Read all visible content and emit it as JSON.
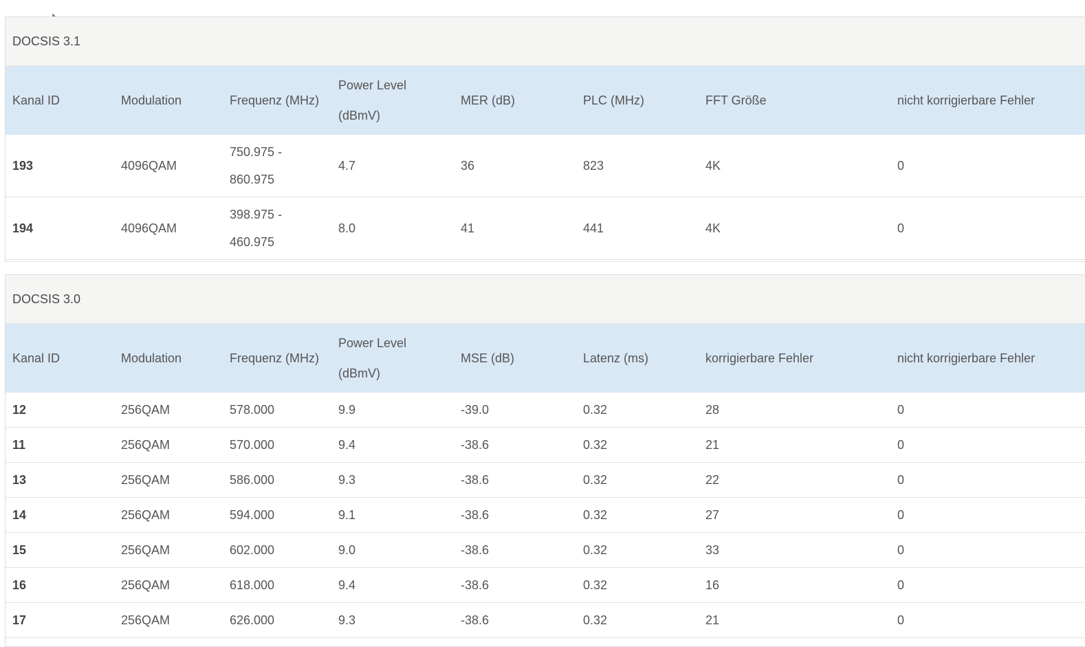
{
  "docsis31": {
    "title": "DOCSIS 3.1",
    "headers": [
      "Kanal ID",
      "Modulation",
      "Frequenz (MHz)",
      "Power Level (dBmV)",
      "MER (dB)",
      "PLC (MHz)",
      "FFT Größe",
      "nicht korrigierbare Fehler"
    ],
    "rows": [
      [
        "193",
        "4096QAM",
        "750.975 - 860.975",
        "4.7",
        "36",
        "823",
        "4K",
        "0"
      ],
      [
        "194",
        "4096QAM",
        "398.975 - 460.975",
        "8.0",
        "41",
        "441",
        "4K",
        "0"
      ]
    ]
  },
  "docsis30": {
    "title": "DOCSIS 3.0",
    "headers": [
      "Kanal ID",
      "Modulation",
      "Frequenz (MHz)",
      "Power Level (dBmV)",
      "MSE (dB)",
      "Latenz (ms)",
      "korrigierbare Fehler",
      "nicht korrigierbare Fehler"
    ],
    "rows": [
      [
        "12",
        "256QAM",
        "578.000",
        "9.9",
        "-39.0",
        "0.32",
        "28",
        "0"
      ],
      [
        "11",
        "256QAM",
        "570.000",
        "9.4",
        "-38.6",
        "0.32",
        "21",
        "0"
      ],
      [
        "13",
        "256QAM",
        "586.000",
        "9.3",
        "-38.6",
        "0.32",
        "22",
        "0"
      ],
      [
        "14",
        "256QAM",
        "594.000",
        "9.1",
        "-38.6",
        "0.32",
        "27",
        "0"
      ],
      [
        "15",
        "256QAM",
        "602.000",
        "9.0",
        "-38.6",
        "0.32",
        "33",
        "0"
      ],
      [
        "16",
        "256QAM",
        "618.000",
        "9.4",
        "-38.6",
        "0.32",
        "16",
        "0"
      ],
      [
        "17",
        "256QAM",
        "626.000",
        "9.3",
        "-38.6",
        "0.32",
        "21",
        "0"
      ]
    ]
  },
  "colors": {
    "header_bg": "#d9e8f5",
    "title_bg": "#f5f5f4",
    "text": "#555555"
  }
}
